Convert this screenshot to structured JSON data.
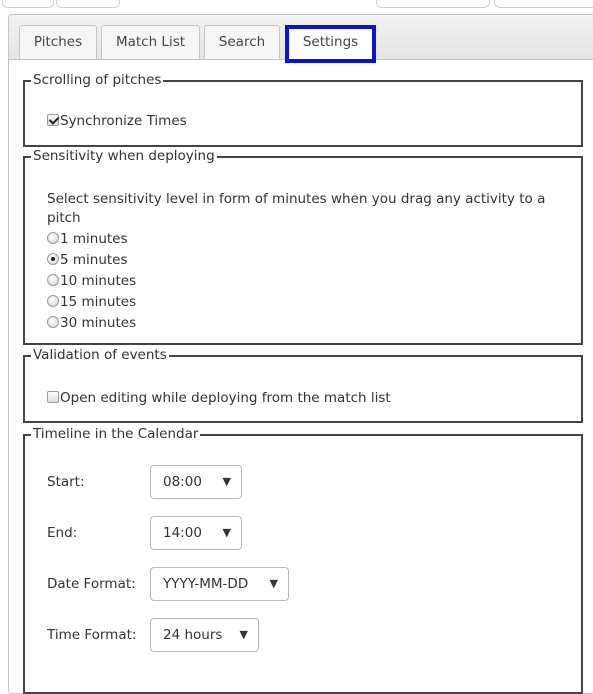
{
  "tabs": [
    {
      "label": "Pitches"
    },
    {
      "label": "Match List"
    },
    {
      "label": "Search"
    },
    {
      "label": "Settings"
    }
  ],
  "active_tab": "Settings",
  "scrolling": {
    "legend": "Scrolling of pitches",
    "sync_label": "Synchronize Times",
    "sync_checked": true
  },
  "sensitivity": {
    "legend": "Sensitivity when deploying",
    "description_line1": "Select sensitivity level in form of minutes when you drag any activity to a",
    "description_line2": "pitch",
    "options": [
      {
        "label": "1 minutes",
        "selected": false
      },
      {
        "label": "5 minutes",
        "selected": true
      },
      {
        "label": "10 minutes",
        "selected": false
      },
      {
        "label": "15 minutes",
        "selected": false
      },
      {
        "label": "30 minutes",
        "selected": false
      }
    ]
  },
  "validation": {
    "legend": "Validation of events",
    "open_editing_label": "Open editing while deploying from the match list",
    "open_editing_checked": false
  },
  "timeline": {
    "legend": "Timeline in the Calendar",
    "start_label": "Start:",
    "start_value": "08:00",
    "end_label": "End:",
    "end_value": "14:00",
    "date_format_label": "Date Format:",
    "date_format_value": "YYYY-MM-DD",
    "time_format_label": "Time Format:",
    "time_format_value": "24 hours"
  },
  "colors": {
    "tab_highlight": "#0a12d6",
    "fieldset_border": "#444444"
  }
}
